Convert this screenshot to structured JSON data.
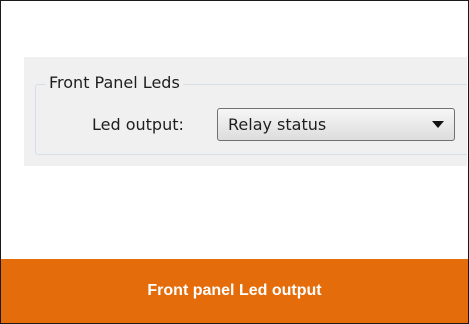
{
  "groupbox": {
    "title": "Front Panel Leds"
  },
  "led_output": {
    "label": "Led output:",
    "selected_value": "Relay status"
  },
  "caption": {
    "text": "Front panel Led output"
  },
  "colors": {
    "caption_background": "#e46c0a",
    "caption_text": "#ffffff",
    "panel_background": "#f0f0f0"
  },
  "icons": {
    "dropdown": "chevron-down-icon"
  }
}
